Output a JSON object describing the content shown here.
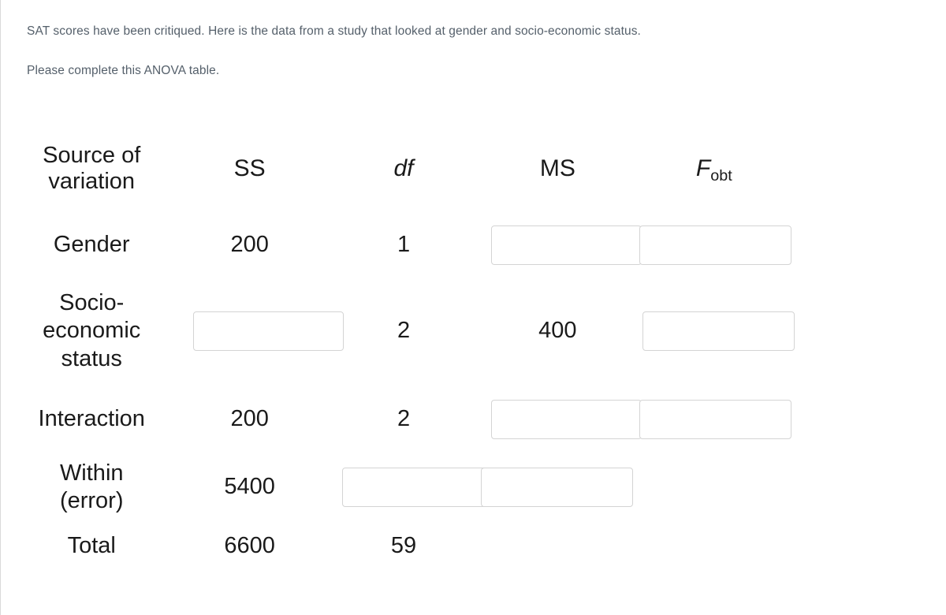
{
  "instructions": {
    "line1": "SAT scores have been critiqued. Here is the data from a study that looked at gender and socio-economic status.",
    "line2": "Please complete this ANOVA table."
  },
  "table": {
    "headers": {
      "source": "Source of variation",
      "source_line1": "Source of",
      "source_line2": "variation",
      "ss": "SS",
      "df": "df",
      "ms": "MS",
      "f_symbol": "F",
      "f_subscript": "obt"
    },
    "rows": [
      {
        "id": "gender",
        "label": "Gender",
        "ss": "200",
        "df": "1",
        "ms": "",
        "ms_is_input": true,
        "f": "",
        "f_is_input": true
      },
      {
        "id": "socio-economic-status",
        "label": "Socio-economic status",
        "label_line1": "Socio-",
        "label_line2": "economic",
        "label_line3": "status",
        "ss": "",
        "ss_is_input": true,
        "df": "2",
        "ms": "400",
        "ms_is_input": false,
        "f": "",
        "f_is_input": true
      },
      {
        "id": "interaction",
        "label": "Interaction",
        "ss": "200",
        "df": "2",
        "ms": "",
        "ms_is_input": true,
        "f": "",
        "f_is_input": true
      },
      {
        "id": "within-error",
        "label": "Within (error)",
        "label_line1": "Within",
        "label_line2": "(error)",
        "ss": "5400",
        "df": "",
        "df_is_input": true,
        "ms": "",
        "ms_is_input": true,
        "f": ""
      },
      {
        "id": "total",
        "label": "Total",
        "ss": "6600",
        "df": "59",
        "ms": "",
        "f": ""
      }
    ]
  },
  "colors": {
    "text_primary": "#1a1a1a",
    "text_muted": "#55606b",
    "input_border": "#d4d4d4",
    "page_border": "#d9d9d9",
    "background": "#ffffff"
  }
}
